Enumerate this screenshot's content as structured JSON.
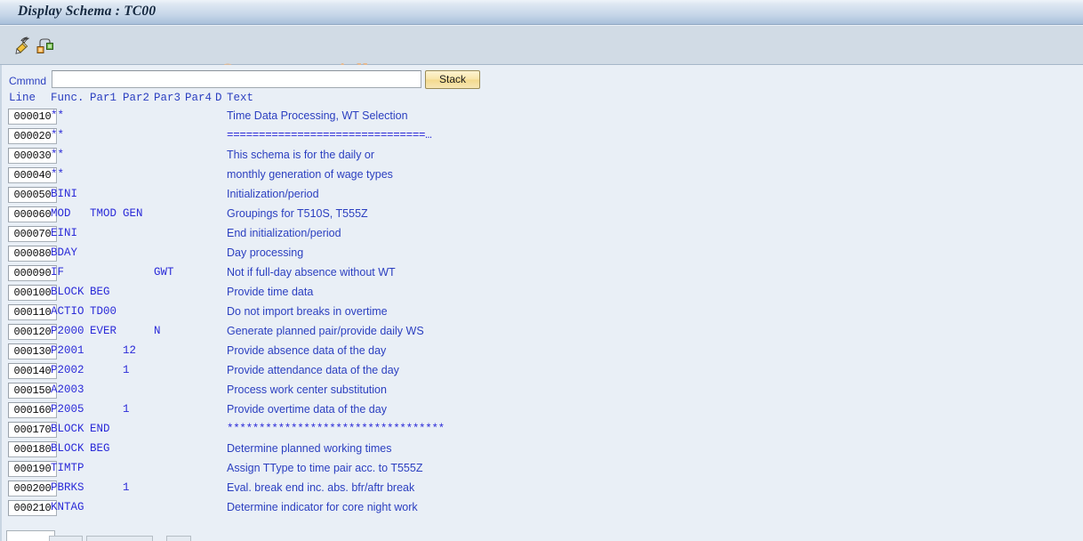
{
  "window": {
    "title": "Display Schema : TC00"
  },
  "toolbar": {
    "icons": [
      {
        "name": "edit-pencil-icon",
        "label": "Display <-> Change"
      },
      {
        "name": "hierarchy-structure-icon",
        "label": "Structure"
      }
    ]
  },
  "watermark": {
    "text": "© www.tutorialkart.com",
    "color": "#e8b98d"
  },
  "command": {
    "label": "Cmmnd",
    "value": "",
    "placeholder": "",
    "stack_label": "Stack"
  },
  "grid": {
    "headers": {
      "line": "Line",
      "func": "Func.",
      "par1": "Par1",
      "par2": "Par2",
      "par3": "Par3",
      "par4": "Par4",
      "d": "D",
      "text": "Text"
    },
    "rows": [
      {
        "line": "000010",
        "func": "**",
        "par1": "",
        "par2": "",
        "par3": "",
        "par4": "",
        "d": "",
        "text": "Time Data Processing, WT Selection",
        "mono": false
      },
      {
        "line": "000020",
        "func": "**",
        "par1": "",
        "par2": "",
        "par3": "",
        "par4": "",
        "d": "",
        "text": "===============================…",
        "mono": true
      },
      {
        "line": "000030",
        "func": "**",
        "par1": "",
        "par2": "",
        "par3": "",
        "par4": "",
        "d": "",
        "text": "This schema is for the daily or",
        "mono": false
      },
      {
        "line": "000040",
        "func": "**",
        "par1": "",
        "par2": "",
        "par3": "",
        "par4": "",
        "d": "",
        "text": "monthly generation of wage types",
        "mono": false
      },
      {
        "line": "000050",
        "func": "BINI",
        "par1": "",
        "par2": "",
        "par3": "",
        "par4": "",
        "d": "",
        "text": "Initialization/period",
        "mono": false
      },
      {
        "line": "000060",
        "func": "MOD",
        "par1": "TMOD",
        "par2": "GEN",
        "par3": "",
        "par4": "",
        "d": "",
        "text": "Groupings for T510S, T555Z",
        "mono": false
      },
      {
        "line": "000070",
        "func": "EINI",
        "par1": "",
        "par2": "",
        "par3": "",
        "par4": "",
        "d": "",
        "text": "End initialization/period",
        "mono": false
      },
      {
        "line": "000080",
        "func": "BDAY",
        "par1": "",
        "par2": "",
        "par3": "",
        "par4": "",
        "d": "",
        "text": "Day processing",
        "mono": false
      },
      {
        "line": "000090",
        "func": "IF",
        "par1": "",
        "par2": "",
        "par3": "GWT",
        "par4": "",
        "d": "",
        "text": "Not if full-day absence without WT",
        "mono": false
      },
      {
        "line": "000100",
        "func": "BLOCK",
        "par1": "BEG",
        "par2": "",
        "par3": "",
        "par4": "",
        "d": "",
        "text": "Provide time data",
        "mono": false
      },
      {
        "line": "000110",
        "func": "ACTIO",
        "par1": "TD00",
        "par2": "",
        "par3": "",
        "par4": "",
        "d": "",
        "text": "Do not import breaks in overtime",
        "mono": false
      },
      {
        "line": "000120",
        "func": "P2000",
        "par1": "EVER",
        "par2": "",
        "par3": "N",
        "par4": "",
        "d": "",
        "text": "Generate planned pair/provide daily WS",
        "mono": false
      },
      {
        "line": "000130",
        "func": "P2001",
        "par1": "",
        "par2": "12",
        "par3": "",
        "par4": "",
        "d": "",
        "text": "Provide absence data of the day",
        "mono": false
      },
      {
        "line": "000140",
        "func": "P2002",
        "par1": "",
        "par2": "1",
        "par3": "",
        "par4": "",
        "d": "",
        "text": "Provide attendance data of the day",
        "mono": false
      },
      {
        "line": "000150",
        "func": "A2003",
        "par1": "",
        "par2": "",
        "par3": "",
        "par4": "",
        "d": "",
        "text": "Process work center substitution",
        "mono": false
      },
      {
        "line": "000160",
        "func": "P2005",
        "par1": "",
        "par2": "1",
        "par3": "",
        "par4": "",
        "d": "",
        "text": "Provide overtime data of the day",
        "mono": false
      },
      {
        "line": "000170",
        "func": "BLOCK",
        "par1": "END",
        "par2": "",
        "par3": "",
        "par4": "",
        "d": "",
        "text": "**********************************",
        "mono": true
      },
      {
        "line": "000180",
        "func": "BLOCK",
        "par1": "BEG",
        "par2": "",
        "par3": "",
        "par4": "",
        "d": "",
        "text": "Determine planned working times",
        "mono": false
      },
      {
        "line": "000190",
        "func": "TIMTP",
        "par1": "",
        "par2": "",
        "par3": "",
        "par4": "",
        "d": "",
        "text": "Assign TType to time pair acc. to T555Z",
        "mono": false
      },
      {
        "line": "000200",
        "func": "PBRKS",
        "par1": "",
        "par2": "1",
        "par3": "",
        "par4": "",
        "d": "",
        "text": "Eval. break end inc. abs. bfr/aftr break",
        "mono": false
      },
      {
        "line": "000210",
        "func": "KNTAG",
        "par1": "",
        "par2": "",
        "par3": "",
        "par4": "",
        "d": "",
        "text": "Determine indicator for core night work",
        "mono": false
      }
    ]
  },
  "theme": {
    "title_gradient_top": "#eef3f9",
    "title_gradient_bottom": "#a9c0db",
    "toolbar_bg": "#d1dbe5",
    "body_bg": "#e9eff6",
    "text_blue": "#2b3fc0",
    "mono_blue": "#2b2bd8",
    "stack_button_bg": "#f8e5a8"
  }
}
